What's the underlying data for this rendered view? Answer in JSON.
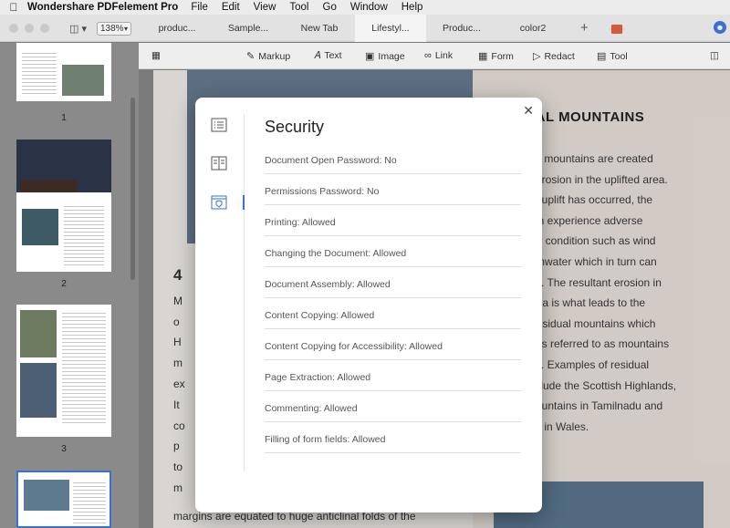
{
  "menubar": {
    "app_name": "Wondershare PDFelement Pro",
    "items": [
      "File",
      "Edit",
      "View",
      "Tool",
      "Go",
      "Window",
      "Help"
    ]
  },
  "titlebar": {
    "zoom": "138%",
    "tabs": [
      "produc...",
      "Sample...",
      "New Tab",
      "Lifestyl...",
      "Produc...",
      "color2"
    ]
  },
  "sidebar": {
    "pages": [
      "1",
      "2",
      "3"
    ]
  },
  "toolbar": {
    "items": [
      "Markup",
      "Text",
      "Image",
      "Link",
      "Form",
      "Redact",
      "Tool"
    ]
  },
  "document": {
    "heading": "RESIDUAL MOUNTAINS",
    "right_lines": [
      "ual mountains are created",
      "o erosion in the uplifted area.",
      "an uplift has occurred, the",
      "can experience adverse",
      "her condition such as wind",
      "rainwater which in turn can",
      "ion. The resultant erosion in",
      "area is what leads to the",
      "f residual mountains which",
      "mes referred to as mountains",
      "ion. Examples of residual",
      "include the Scottish Highlands,",
      "Mountains in Tamilnadu and",
      "nia in Wales."
    ],
    "left_big": "4",
    "left_letters": [
      "M",
      "o",
      "H",
      "m",
      "ex",
      "It",
      "co",
      "p",
      "to",
      "m"
    ],
    "bottom_line": "margins are equated to huge anticlinal folds of the"
  },
  "modal": {
    "title": "Security",
    "rows": [
      "Document Open Password: No",
      "Permissions Password: No",
      "Printing: Allowed",
      "Changing the Document: Allowed",
      "Document Assembly: Allowed",
      "Content Copying: Allowed",
      "Content Copying for Accessibility: Allowed",
      "Page Extraction: Allowed",
      "Commenting: Allowed",
      "Filling of form fields: Allowed"
    ]
  },
  "colors": {
    "accent": "#3a6fd8"
  }
}
